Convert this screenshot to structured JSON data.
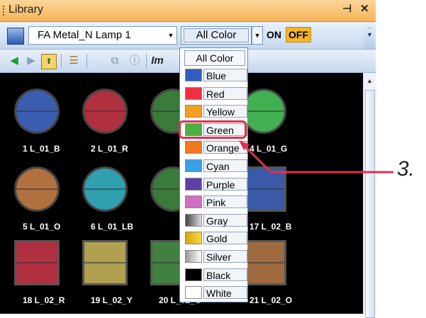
{
  "window": {
    "title": "Library",
    "pin_icon": "pin-icon",
    "close_icon": "close-icon"
  },
  "toolbar": {
    "library_icon": "library-icon",
    "library_selected": "FA Metal_N Lamp 1",
    "color_filter": "All Color",
    "on_label": "ON",
    "off_label": "OFF"
  },
  "toolbar2": {
    "icons": [
      "back-icon",
      "forward-icon",
      "up-folder-icon",
      "tree-icon",
      "copy-icon",
      "info-icon",
      "image-icon"
    ]
  },
  "lamps": [
    {
      "label": "1 L_01_B",
      "color": "#3b5db0"
    },
    {
      "label": "2 L_01_R",
      "color": "#b03040"
    },
    {
      "label": "",
      "color": "#3a7a3a"
    },
    {
      "label": "4 L_01_G",
      "color": "#40b050"
    },
    {
      "label": "5 L_01_O",
      "color": "#b07040"
    },
    {
      "label": "6 L_01_LB",
      "color": "#30a0b0"
    },
    {
      "label": "",
      "color": "#3a7a3a"
    },
    {
      "label": "17 L_02_B",
      "color": "#3a5aa8"
    },
    {
      "label": "18 L_02_R",
      "color": "#b03040"
    },
    {
      "label": "19 L_02_Y",
      "color": "#b0a050"
    },
    {
      "label": "20 L_02_G",
      "color": "#408040"
    },
    {
      "label": "21 L_02_O",
      "color": "#a06a40"
    }
  ],
  "color_dropdown": {
    "header": "All Color",
    "items": [
      {
        "label": "Blue",
        "color": "#2f5fc0"
      },
      {
        "label": "Red",
        "color": "#f03040"
      },
      {
        "label": "Yellow",
        "color": "#f5a020"
      },
      {
        "label": "Green",
        "color": "#4cb040"
      },
      {
        "label": "Orange",
        "color": "#f07820"
      },
      {
        "label": "Cyan",
        "color": "#3aa0e8"
      },
      {
        "label": "Purple",
        "color": "#6040a8"
      },
      {
        "label": "Pink",
        "color": "#d070c0"
      },
      {
        "label": "Gray",
        "color": "#888888"
      },
      {
        "label": "Gold",
        "color": "#e8c020"
      },
      {
        "label": "Silver",
        "color": "#c8c8c8"
      },
      {
        "label": "Black",
        "color": "#000000"
      },
      {
        "label": "White",
        "color": "#ffffff"
      }
    ],
    "highlighted": "Green"
  },
  "callout": {
    "text": "3."
  }
}
